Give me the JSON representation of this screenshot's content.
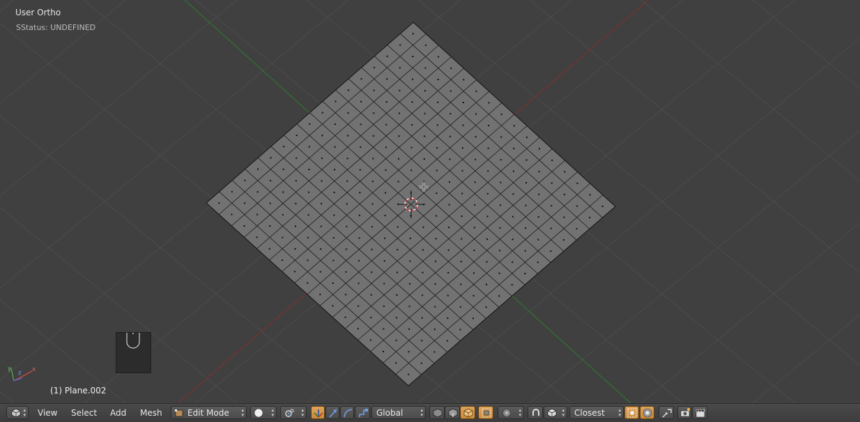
{
  "viewport": {
    "title": "User Ortho",
    "status": "SStatus: UNDEFINED",
    "object_name": "(1) Plane.002",
    "axes": {
      "x": "x",
      "y": "y",
      "z": "z"
    }
  },
  "header": {
    "menus": {
      "view": "View",
      "select": "Select",
      "add": "Add",
      "mesh": "Mesh"
    },
    "mode": "Edit Mode",
    "transform_orientation": "Global",
    "snap_target": "Closest"
  },
  "colors": {
    "viewport_bg": "#404040",
    "mesh_face": "#727272",
    "grid_line": "#4c4c4c",
    "x_axis": "#8b2c2c",
    "y_axis": "#2c7d2c",
    "active_orange": "#d89a4c"
  },
  "icons": [
    "editor-type-cube-icon",
    "viewport-shading-solid-icon",
    "pivot-point-icon",
    "manipulator-toggle-icon",
    "translate-arrow-icon",
    "rotate-arc-icon",
    "scale-icon",
    "layer-vertex-select-icon",
    "edge-select-icon",
    "face-select-icon",
    "limit-selection-icon",
    "proportional-edit-icon",
    "snap-magnet-icon",
    "snap-element-cube-icon",
    "snap-icon-a",
    "snap-icon-b",
    "open-gl-render-icon",
    "camera-render-icon",
    "clapper-render-icon"
  ]
}
